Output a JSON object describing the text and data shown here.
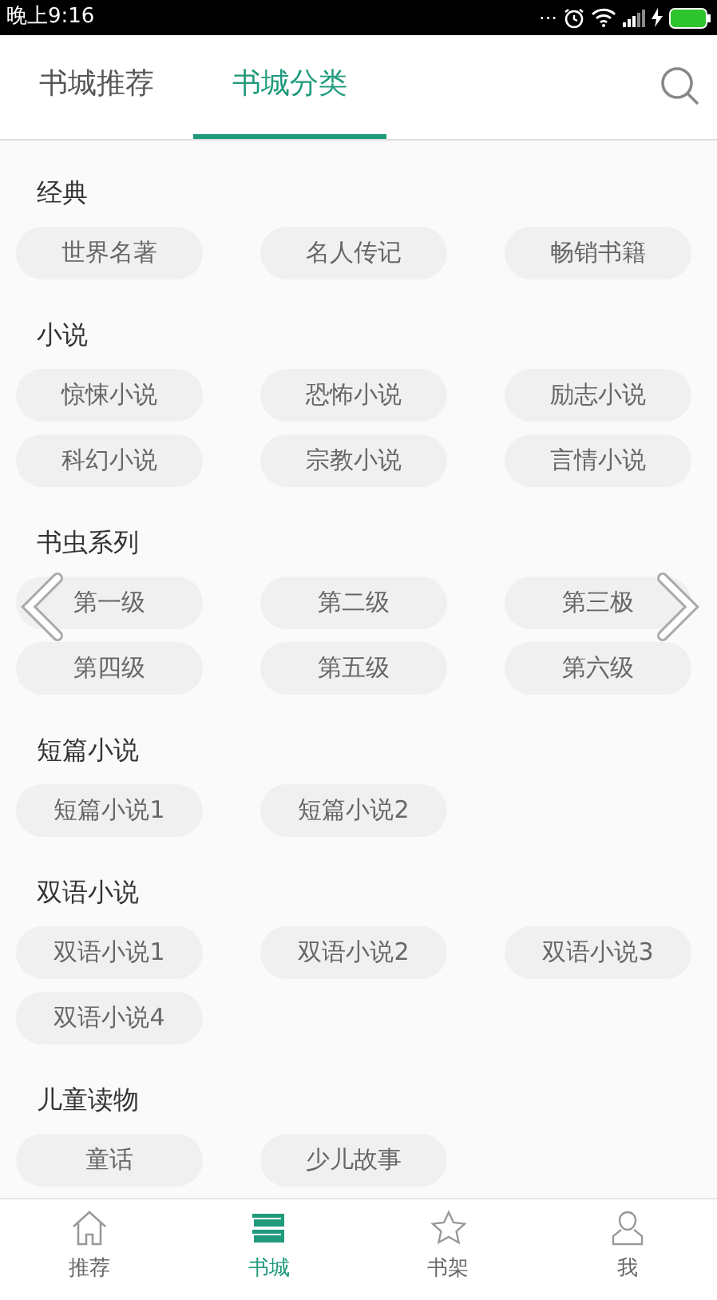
{
  "status_bar": {
    "time": "晚上9:16",
    "dots": "..."
  },
  "tabs": [
    {
      "label": "书城推荐",
      "selected": false
    },
    {
      "label": "书城分类",
      "selected": true
    }
  ],
  "sections": [
    {
      "title": "经典",
      "items": [
        "世界名著",
        "名人传记",
        "畅销书籍"
      ]
    },
    {
      "title": "小说",
      "items": [
        "惊悚小说",
        "恐怖小说",
        "励志小说",
        "科幻小说",
        "宗教小说",
        "言情小说"
      ]
    },
    {
      "title": "书虫系列",
      "items": [
        "第一级",
        "第二级",
        "第三极",
        "第四级",
        "第五级",
        "第六级"
      ]
    },
    {
      "title": "短篇小说",
      "items": [
        "短篇小说1",
        "短篇小说2"
      ]
    },
    {
      "title": "双语小说",
      "items": [
        "双语小说1",
        "双语小说2",
        "双语小说3",
        "双语小说4"
      ]
    },
    {
      "title": "儿童读物",
      "items": [
        "童话",
        "少儿故事"
      ]
    }
  ],
  "bottom_nav": [
    {
      "label": "推荐",
      "selected": false
    },
    {
      "label": "书城",
      "selected": true
    },
    {
      "label": "书架",
      "selected": false
    },
    {
      "label": "我",
      "selected": false
    }
  ]
}
